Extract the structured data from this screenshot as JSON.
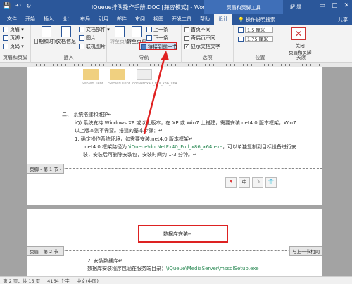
{
  "titlebar": {
    "doc_title": "iQueue排队操作手册.DOC [兼容模式] - Word",
    "context_tools": "页眉和页脚工具",
    "user": "解 题",
    "save_glyph": "💾",
    "undo_glyph": "↶",
    "redo_glyph": "↻",
    "min_glyph": "▭",
    "max_glyph": "▢",
    "close_glyph": "✕"
  },
  "tabs": [
    "文件",
    "开始",
    "插入",
    "设计",
    "布局",
    "引用",
    "邮件",
    "审阅",
    "视图",
    "开发工具",
    "帮助",
    "设计"
  ],
  "active_tab_index": 11,
  "tell_me": "操作说明搜索",
  "share": "共享",
  "ribbon": {
    "hf_group": {
      "items": [
        "页眉 ▾",
        "页脚 ▾",
        "页码 ▾"
      ],
      "label": "页眉和页脚"
    },
    "insert_group": {
      "date_time": "日期和时间",
      "doc_info": "文档信息",
      "doc_parts": "文档部件 ▾",
      "pictures": "图片",
      "online_pictures": "联机图片",
      "label": "插入"
    },
    "nav_group": {
      "goto_header": "转至页眉",
      "goto_footer": "转至页脚",
      "previous": "上一条",
      "next": "下一条",
      "link_previous": "链接到前一节",
      "label": "导航"
    },
    "options_group": {
      "diff_first": "首页不同",
      "diff_odd_even": "奇偶页不同",
      "show_doc_text": "显示文档文字",
      "label": "选项"
    },
    "position_group": {
      "header_pos": "1.5 厘米",
      "footer_pos": "1.75 厘米",
      "label": "位置"
    },
    "close_group": {
      "close_label": "关闭\n页眉和页脚",
      "label": "关闭"
    }
  },
  "page1": {
    "thumbs": [
      "ServerClient",
      "ServerClient",
      "dotNetFx40_Full_x86_x64"
    ],
    "heading": "二、  系统搭建和维护↵",
    "line1": "iQ) 系统支持 Windows XP 或以上版本，在 XP 或 Win7 上搭建，需要安装.net4.0 版本框架，Win7",
    "line2": "以上版本则不需要。搭建的基本步骤：↵",
    "line3": "1.   确定操作系统环境，如需要安装.net4.0 版本框架↵",
    "line4_pre": ".net4.0 框架路径为 ",
    "line4_link": "\\iQueue\\dotNetFx40_Full_x86_x64.exe",
    "line4_post": "，可以单独复制到目标设备进行安",
    "line5": "装，安装后可删除安装包，安装时间约 1-3 分钟。↵",
    "footer_label": "页脚 - 第 1 节 -",
    "ime_icons": [
      "S",
      "中",
      "☽",
      "👕"
    ]
  },
  "page2": {
    "header_title": "数据库安装↵",
    "header_label": "页眉 - 第 2 节 -",
    "same_as_prev": "与上一节相同",
    "step": "2.   安装数据库↵",
    "line": "数据库安装程序包涵在服务端目录：",
    "line_link": "\\iQueue\\MediaServer\\mssqlSetup.exe"
  },
  "statusbar": {
    "page": "第 2 页，共 15 页",
    "words": "4164 个字",
    "lang": "中文(中国)"
  },
  "colors": {
    "brand": "#2b579a",
    "highlight": "#d22222"
  }
}
